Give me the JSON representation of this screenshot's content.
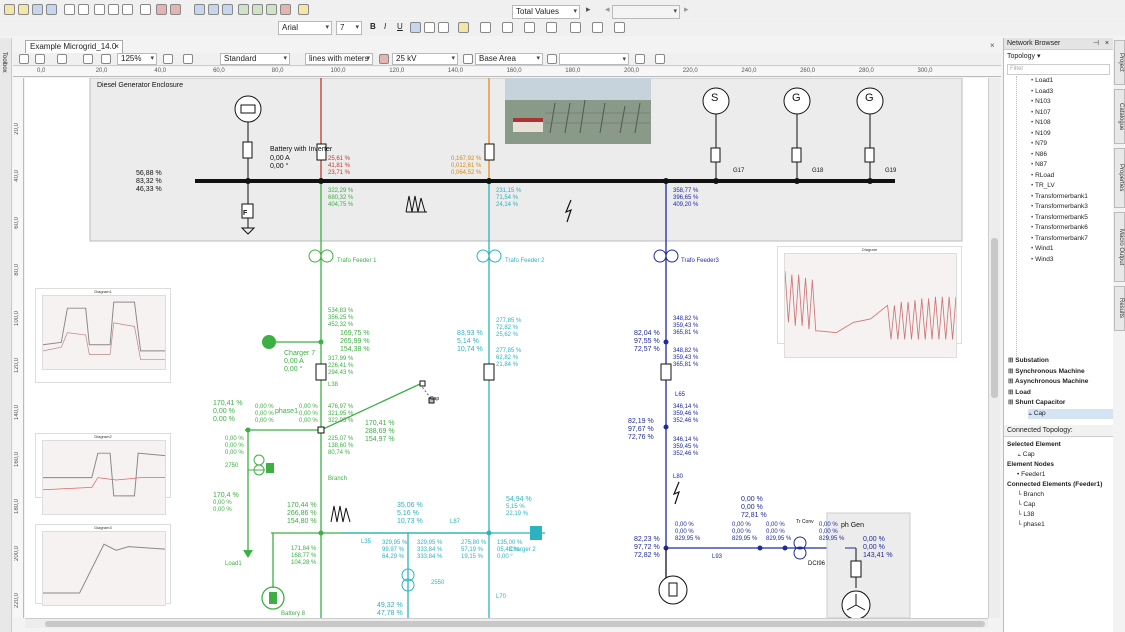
{
  "toolbar": {
    "font": "Arial",
    "font_size": "7",
    "bold": "B",
    "italic": "I",
    "underline": "U",
    "values_mode": "Total Values",
    "values_field": ""
  },
  "toolbar2": {
    "zoom": "125%",
    "style": "Standard",
    "line_style": "lines with meters",
    "voltage": "25 kV",
    "area": "Base Area"
  },
  "left_rail": {
    "toolbox": "Toolbox"
  },
  "tab": {
    "title": "Example Microgrid_14.0",
    "close": "×"
  },
  "ruler": {
    "ticks": [
      "0,0",
      "20,0",
      "40,0",
      "60,0",
      "80,0",
      "100,0",
      "120,0",
      "140,0",
      "160,0",
      "180,0",
      "200,0",
      "220,0",
      "240,0",
      "260,0",
      "280,0",
      "300,0"
    ],
    "vticks": [
      "20,0",
      "40,0",
      "60,0",
      "80,0",
      "100,0",
      "120,0",
      "140,0",
      "160,0",
      "180,0",
      "200,0",
      "220,0"
    ]
  },
  "diagram": {
    "enclosure": "Diesel Generator Enclosure",
    "battery_inverter": {
      "name": "Battery with Inverter",
      "vals": [
        "0,00 A",
        "0,00 °"
      ]
    },
    "left_vals": [
      "56,88 %",
      "83,32 %",
      "46,33 %"
    ],
    "red_vals": [
      "25,61 %",
      "41,81 %",
      "23,71 %"
    ],
    "orange_vals": [
      "0,167,92 %",
      "0,012,61 %",
      "0,064,52 %"
    ],
    "green_top": [
      "322,29 %",
      "680,32 %",
      "404,75 %"
    ],
    "cyan_top": [
      "231,15 %",
      "71,54 %",
      "24,14 %"
    ],
    "blue_top": [
      "358,77 %",
      "396,65 %",
      "409,20 %"
    ],
    "gens": [
      {
        "sym": "S",
        "name": ""
      },
      {
        "sym": "G",
        "name": "G17"
      },
      {
        "sym": "G",
        "name": "G18"
      },
      {
        "sym": "G",
        "name": "G19"
      }
    ],
    "fuse": "F",
    "trafo1": "Trafo Feeder 1",
    "trafo2": "Trafo Feeder 2",
    "trafo3": "Trafo Feeder3",
    "green_mid": [
      "534,83 %",
      "356,25 %",
      "452,32 %"
    ],
    "green_charger": [
      "169,75 %",
      "265,99 %",
      "154,38 %"
    ],
    "charger": "Charger 7",
    "charger_vals": [
      "0,00 A",
      "0,00 °"
    ],
    "green_l38": [
      "317,99 %",
      "226,41 %",
      "294,43 %"
    ],
    "l38": "L38",
    "cyan_mid": [
      "83,93 %",
      "5,14 %",
      "10,74 %"
    ],
    "cyan_mid2": [
      "277,85 %",
      "72,82 %",
      "25,62 %"
    ],
    "cyan_mid3": [
      "277,85 %",
      "62,82 %",
      "21,84 %"
    ],
    "blue_mid": [
      "82,04 %",
      "97,55 %",
      "72,57 %"
    ],
    "blue_mid_r": [
      "348,82 %",
      "359,43 %",
      "365,81 %"
    ],
    "blue_mid_r2": [
      "348,82 %",
      "359,43 %",
      "365,81 %"
    ],
    "l65": "L65",
    "blue_low": [
      "82,19 %",
      "97,67 %",
      "72,76 %"
    ],
    "blue_low_r": [
      "346,14 %",
      "359,46 %",
      "352,46 %"
    ],
    "blue_low_r2": [
      "346,14 %",
      "359,45 %",
      "352,46 %"
    ],
    "l80": "L80",
    "phase_left": [
      "170,41 %",
      "0,00 %",
      "0,00 %"
    ],
    "phase1": "phase1",
    "phase_vals": [
      "0,00 %",
      "0,00 %",
      "0,00 %"
    ],
    "phase_vals2": [
      "0,00 %",
      "0,00 %",
      "0,00 %"
    ],
    "green_branch": [
      "476,97 %",
      "321,95 %",
      "322,05 %"
    ],
    "branch_right": [
      "170,41 %",
      "288,69 %",
      "154,97 %"
    ],
    "green_branch2": [
      "225,07 %",
      "138,60 %",
      "80,74 %"
    ],
    "cap": "Cap",
    "branch": "Branch",
    "small_g1": [
      "0,00 %",
      "0,00 %",
      "0,00 %"
    ],
    "small_g2": [
      "0,00 %",
      "0,00 %",
      "0,00 %"
    ],
    "tr2750": "2750",
    "small_g3": [
      "170,4 %",
      "0,00 %",
      "0,00 %"
    ],
    "load1": "Load1",
    "green_low": [
      "170,44 %",
      "266,86 %",
      "154,80 %"
    ],
    "green_low2": [
      "171,84 %",
      "168,77 %",
      "104,28 %"
    ],
    "battery8": "Battery 8",
    "l35": "L35",
    "cyan_low": [
      "35,06 %",
      "5,16 %",
      "10,73 %"
    ],
    "l87": "L87",
    "cyan_low2": [
      "329,95 %",
      "99,97 %",
      "64,29 %"
    ],
    "cyan_low3": [
      "329,95 %",
      "333,84 %",
      "333,84 %"
    ],
    "cyan_low4": [
      "275,80 %",
      "57,19 %",
      "19,15 %"
    ],
    "cyan_r": [
      "54,94 %",
      "5,15 %",
      "22,19 %"
    ],
    "cyan_r2": [
      "135,00 %",
      "05,43 %",
      "0,00 °"
    ],
    "charger2": "Charger 2",
    "cyan_2550": "2550",
    "cyan_b": [
      "49,32 %",
      "47,78 %"
    ],
    "l70": "L70",
    "blue_bottom": [
      "82,23 %",
      "97,72 %",
      "72,82 %"
    ],
    "blue_bottom_r": [
      "0,00 %",
      "0,00 %",
      "829,95 %"
    ],
    "l93": "L93",
    "mid_vals": [
      "0,00 %",
      "0,00 %",
      "72,81 %"
    ],
    "mid_vals2": [
      "0,00 %",
      "0,00 %",
      "829,95 %"
    ],
    "mid_vals3": [
      "0,00 %",
      "0,00 %",
      "829,95 %"
    ],
    "mid_vals4": [
      "0,00 %",
      "0,00 %",
      "829,95 %"
    ],
    "trconv": "Tr Conv",
    "dci": "DCI96",
    "phgen": "ph Gen",
    "phgen_vals": [
      "0,00 %",
      "0,00 %",
      "143,41 %"
    ],
    "phgen_left": [
      "0,00 %",
      "0,00 %"
    ],
    "plot_titles": [
      "Diagram",
      "Diagram1",
      "Diagram2",
      "Diagram3"
    ]
  },
  "network_browser": {
    "title": "Network Browser",
    "topology": "Topology ▾",
    "filter_placeholder": "Filter",
    "items": [
      "Load1",
      "Load3",
      "N103",
      "N107",
      "N108",
      "N109",
      "N79",
      "N86",
      "N87",
      "RLoad",
      "TR_LV",
      "Transformerbank1",
      "Transformerbank3",
      "Transformerbank5",
      "Transformerbank6",
      "Transformerbank7",
      "Wind1",
      "Wind3"
    ],
    "groups": [
      "Substation",
      "Synchronous Machine",
      "Asynchronous Machine",
      "Load",
      "Shunt Capacitor"
    ],
    "selected": "Cap",
    "connected_title": "Connected Topology:",
    "selected_element": "Selected Element",
    "sel_cap": "Cap",
    "element_nodes": "Element Nodes",
    "feeder": "Feeder1",
    "connected_elements": "Connected Elements (Feeder1)",
    "conn_items": [
      "Branch",
      "Cap",
      "L38",
      "phase1"
    ]
  },
  "right_rail": [
    "Project",
    "Catalogue",
    "Properties",
    "Macro Output",
    "Results"
  ],
  "colors": {
    "red": "#c0392b",
    "orange": "#e08a1e",
    "green": "#3cb043",
    "cyan": "#2bb3c0",
    "blue": "#1f2a9e",
    "black": "#111111"
  }
}
